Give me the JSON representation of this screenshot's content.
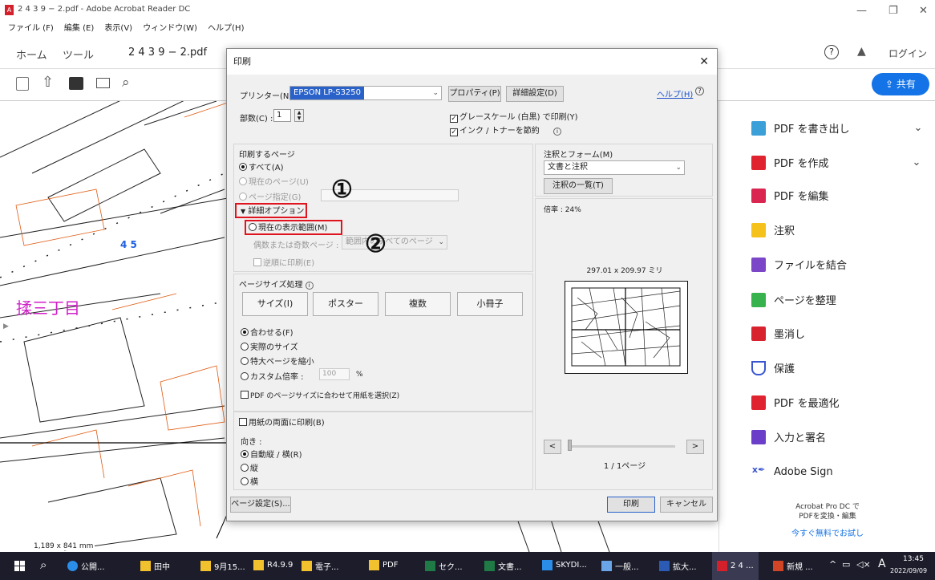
{
  "window": {
    "title": "2 4 3 9 − 2.pdf - Adobe Acrobat Reader DC"
  },
  "menu": [
    "ファイル (F)",
    "編集 (E)",
    "表示(V)",
    "ウィンドウ(W)",
    "ヘルプ(H)"
  ],
  "tabs": {
    "home": "ホーム",
    "tools": "ツール",
    "doc": "2 4 3 9 − 2.pdf",
    "login": "ログイン"
  },
  "toolbar": {
    "share": "共有"
  },
  "doc": {
    "label_45": "4 5",
    "label_street": "揉三丁目",
    "page_size": "1,189 x 841 mm"
  },
  "dialog": {
    "title": "印刷",
    "printer_label": "プリンター(N) :",
    "printer_value": "EPSON LP-S3250",
    "properties": "プロパティ(P)",
    "advanced": "詳細設定(D)",
    "help": "ヘルプ(H)",
    "copies_label": "部数(C) :",
    "copies_value": "1",
    "grayscale": "グレースケール (白黒) で印刷(Y)",
    "save_ink": "インク / トナーを節約",
    "pages_header": "印刷するページ",
    "all": "すべて(A)",
    "current_page": "現在のページ(U)",
    "page_spec": "ページ指定(G)",
    "more_options": "詳細オプション",
    "current_view": "現在の表示範囲(M)",
    "odd_even_label": "偶数または奇数ページ :",
    "odd_even_value": "範囲内のすべてのページ",
    "reverse": "逆順に印刷(E)",
    "sizing_header": "ページサイズ処理",
    "size_btn": "サイズ(I)",
    "poster_btn": "ポスター",
    "multiple_btn": "複数",
    "booklet_btn": "小冊子",
    "fit": "合わせる(F)",
    "actual": "実際のサイズ",
    "shrink": "特大ページを縮小",
    "custom_scale": "カスタム倍率 :",
    "custom_value": "100",
    "percent": "%",
    "choose_paper": "PDF のページサイズに合わせて用紙を選択(Z)",
    "duplex": "用紙の両面に印刷(B)",
    "orientation": "向き :",
    "auto": "自動縦 / 横(R)",
    "portrait": "縦",
    "landscape": "横",
    "comments_header": "注釈とフォーム(M)",
    "comments_value": "文書と注釈",
    "comments_list": "注釈の一覧(T)",
    "zoom": "倍率 : 24%",
    "preview_size": "297.01 x 209.97 ミリ",
    "page_count": "1 / 1ページ",
    "page_setup": "ページ設定(S)...",
    "print": "印刷",
    "cancel": "キャンセル",
    "annot1": "①",
    "annot2": "②"
  },
  "rightpanel": {
    "items": [
      "PDF を書き出し",
      "PDF を作成",
      "PDF を編集",
      "注釈",
      "ファイルを結合",
      "ページを整理",
      "墨消し",
      "保護",
      "PDF を最適化",
      "入力と署名",
      "Adobe Sign"
    ],
    "promo1": "Acrobat Pro DC で",
    "promo2": "PDFを変換・編集",
    "promo_link": "今すぐ無料でお試し"
  },
  "taskbar": {
    "items": [
      "公開...",
      "田中",
      "9月15...",
      "R4.9.9",
      "電子...",
      "PDF",
      "セク...",
      "文書...",
      "SKYDI...",
      "一般...",
      "拡大...",
      "2 4 ...",
      "新規 ..."
    ],
    "ime": "A",
    "time": "13:45",
    "date": "2022/09/09"
  }
}
